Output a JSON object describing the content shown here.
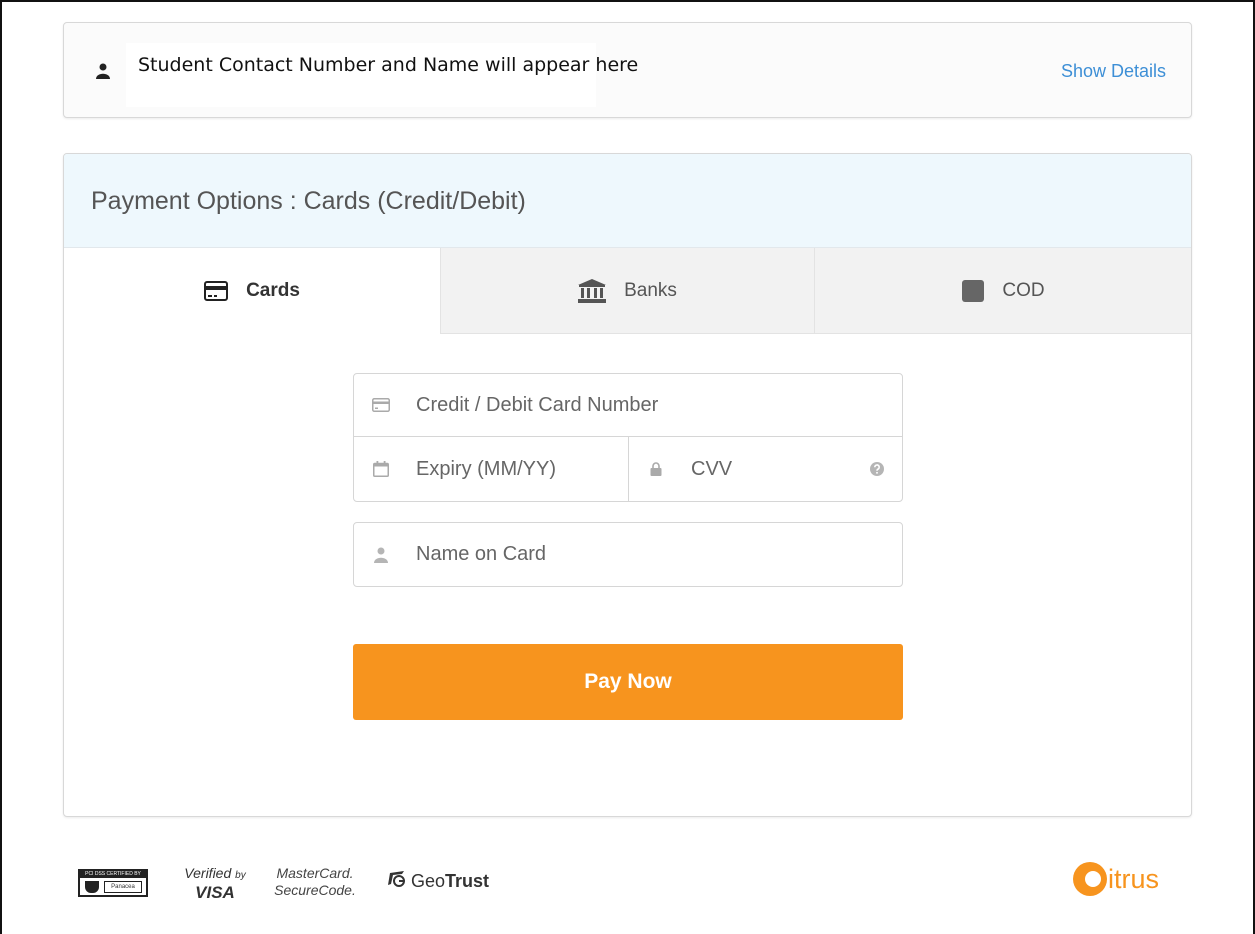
{
  "student": {
    "info_text": "Student Contact Number and Name will appear here",
    "show_details_label": "Show Details",
    "icon": "user-icon"
  },
  "payment": {
    "title": "Payment Options : Cards (Credit/Debit)",
    "tabs": [
      {
        "label": "Cards",
        "icon": "credit-card-icon",
        "active": true
      },
      {
        "label": "Banks",
        "icon": "bank-icon",
        "active": false
      },
      {
        "label": "COD",
        "icon": "cod-icon",
        "active": false
      }
    ],
    "form": {
      "card_number_placeholder": "Credit / Debit Card Number",
      "expiry_placeholder": "Expiry (MM/YY)",
      "cvv_placeholder": "CVV",
      "name_placeholder": "Name on Card"
    },
    "pay_button_label": "Pay Now"
  },
  "footer": {
    "pci_top_text": "PCI DSS CERTIFIED BY",
    "pci_text": "Panacea",
    "visa_line1": "Verified",
    "visa_by": "by",
    "visa_line2": "VISA",
    "mastercard_line1": "MasterCard.",
    "mastercard_line2": "SecureCode.",
    "geotrust_prefix": "Geo",
    "geotrust_suffix": "Trust",
    "citrus_text": "itrus"
  },
  "colors": {
    "accent": "#f7941e",
    "link": "#3d8fd6",
    "header_bg": "#eef8fd"
  }
}
